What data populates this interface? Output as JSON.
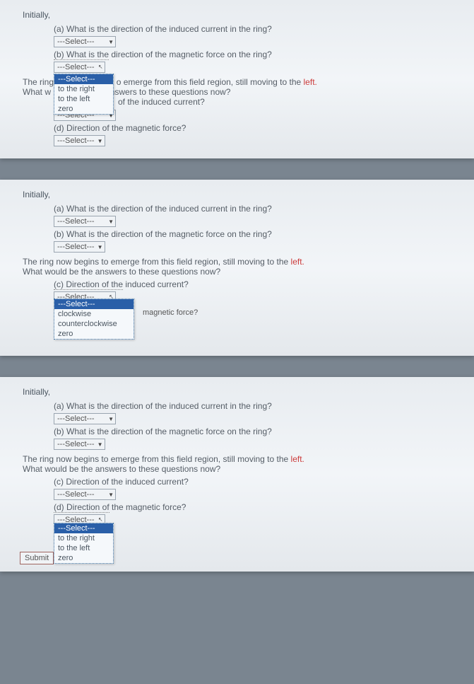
{
  "initially": "Initially,",
  "qa": "(a) What is the direction of the induced current in the ring?",
  "qb": "(b) What is the direction of the magnetic force on the ring?",
  "qb_dotted": "(b) What is the",
  "qb_after": " direction of the magnetic force on the ring?",
  "sel_placeholder": "---Select---",
  "emerge_full": "The ring now begins to emerge from this field region, still moving to the ",
  "left_word": "left.",
  "emerge_p1_a": "The ring",
  "emerge_p1_b": "o emerge from this field region, still moving to the ",
  "answers": "What would be the answers to these questions now?",
  "answers_p1_a": "What w",
  "answers_p1_b": "nswers to these questions now?",
  "qc": "(c) Direction of the induced current?",
  "qc_dotted": "(c) Direction of the",
  "qc_after": " induced current?",
  "qc_p1_after": "of the induced current?",
  "qd": "(d) Direction of the magnetic force?",
  "qd_dotted": "(d) Direction of",
  "qd_after": " the magnetic force?",
  "qd_p2_after": " magnetic force?",
  "opts_dir": {
    "sel": "---Select---",
    "right": "to the right",
    "left": "to the left",
    "zero": "zero"
  },
  "opts_rot": {
    "sel": "---Select---",
    "cw": "clockwise",
    "ccw": "counterclockwise",
    "zero": "zero"
  },
  "submit": "Submit"
}
